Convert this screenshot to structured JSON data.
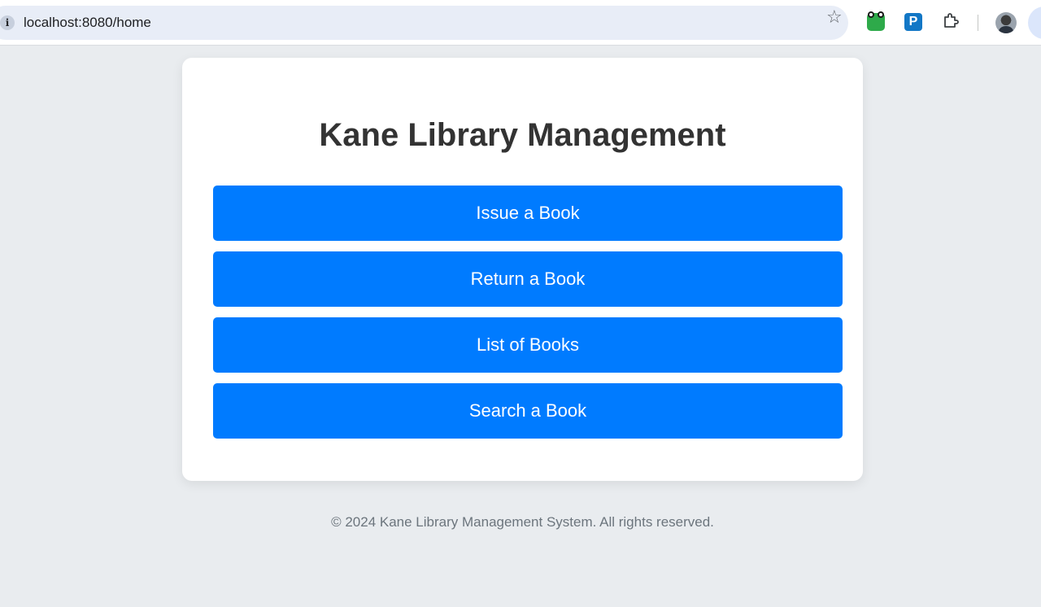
{
  "browser": {
    "url": "localhost:8080/home",
    "icons": [
      "info-icon",
      "bookmark-star-icon",
      "frog-extension-icon",
      "p-extension-icon",
      "extensions-puzzle-icon",
      "profile-avatar"
    ],
    "p_extension_letter": "P"
  },
  "main": {
    "title": "Kane Library Management",
    "buttons": [
      {
        "label": "Issue a Book"
      },
      {
        "label": "Return a Book"
      },
      {
        "label": "List of Books"
      },
      {
        "label": "Search a Book"
      }
    ]
  },
  "footer": {
    "text": "© 2024 Kane Library Management System. All rights reserved."
  },
  "colors": {
    "page_background": "#e9ecef",
    "button": "#007bff",
    "title": "#333333",
    "footer_text": "#6c757d"
  }
}
